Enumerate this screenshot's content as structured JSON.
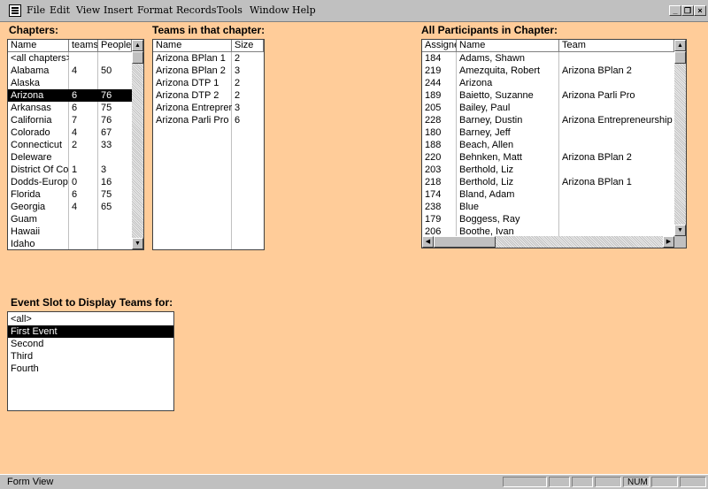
{
  "menu": [
    "File",
    "Edit",
    "View",
    "Insert",
    "Format",
    "Records",
    "Tools",
    "Window",
    "Help"
  ],
  "window_buttons": {
    "minimize": "_",
    "restore": "❐",
    "close": "×"
  },
  "chapters": {
    "label": "Chapters:",
    "columns": [
      "Name",
      "teams",
      "People"
    ],
    "rows": [
      [
        "<all chapters>",
        "",
        ""
      ],
      [
        "Alabama",
        "4",
        "50"
      ],
      [
        "Alaska",
        "",
        ""
      ],
      [
        "Arizona",
        "6",
        "76"
      ],
      [
        "Arkansas",
        "6",
        "75"
      ],
      [
        "California",
        "7",
        "76"
      ],
      [
        "Colorado",
        "4",
        "67"
      ],
      [
        "Connecticut",
        "2",
        "33"
      ],
      [
        "Deleware",
        "",
        ""
      ],
      [
        "District Of Co",
        "1",
        "3"
      ],
      [
        "Dodds-Europ",
        "0",
        "16"
      ],
      [
        "Florida",
        "6",
        "75"
      ],
      [
        "Georgia",
        "4",
        "65"
      ],
      [
        "Guam",
        "",
        ""
      ],
      [
        "Hawaii",
        "",
        ""
      ],
      [
        "Idaho",
        "",
        ""
      ]
    ],
    "selected": "Arizona"
  },
  "teams": {
    "label": "Teams in that chapter:",
    "columns": [
      "Name",
      "Size"
    ],
    "rows": [
      [
        "Arizona BPlan 1",
        "2"
      ],
      [
        "Arizona BPlan 2",
        "3"
      ],
      [
        "Arizona DTP 1",
        "2"
      ],
      [
        "Arizona DTP 2",
        "2"
      ],
      [
        "Arizona Entreprer",
        "3"
      ],
      [
        "Arizona Parli Pro",
        "6"
      ]
    ]
  },
  "participants": {
    "label": "All Participants in Chapter:",
    "columns": [
      "Assigne",
      "Name",
      "Team"
    ],
    "rows": [
      [
        "184",
        "Adams, Shawn",
        ""
      ],
      [
        "219",
        "Amezquita, Robert",
        "Arizona BPlan 2"
      ],
      [
        "244",
        "Arizona",
        ""
      ],
      [
        "189",
        "Baietto, Suzanne",
        "Arizona Parli Pro"
      ],
      [
        "205",
        "Bailey, Paul",
        ""
      ],
      [
        "228",
        "Barney, Dustin",
        "Arizona Entrepreneurship"
      ],
      [
        "180",
        "Barney, Jeff",
        ""
      ],
      [
        "188",
        "Beach, Allen",
        ""
      ],
      [
        "220",
        "Behnken, Matt",
        "Arizona BPlan 2"
      ],
      [
        "203",
        "Berthold, Liz",
        ""
      ],
      [
        "218",
        "Berthold, Liz",
        "Arizona BPlan 1"
      ],
      [
        "174",
        "Bland, Adam",
        ""
      ],
      [
        "238",
        "Blue",
        ""
      ],
      [
        "179",
        "Boggess, Ray",
        ""
      ],
      [
        "206",
        "Boothe, Ivan",
        ""
      ]
    ]
  },
  "event_slot": {
    "label": "Event Slot to Display Teams for:",
    "options": [
      "<all>",
      "First Event",
      "Second",
      "Third",
      "Fourth"
    ],
    "selected": "First Event"
  },
  "status": {
    "text": "Form View",
    "num": "NUM"
  }
}
